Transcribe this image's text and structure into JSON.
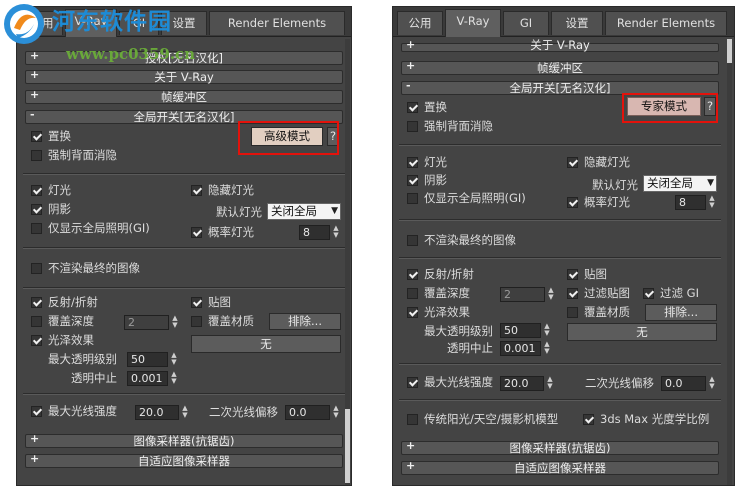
{
  "watermark": {
    "title": "河东软件园",
    "url": "www.pc0359.cn"
  },
  "left": {
    "tabs": [
      "公用",
      "V-Ray",
      "GI",
      "设置",
      "Render Elements"
    ],
    "rollouts_top": [
      {
        "sign": "+",
        "label": "授权[无名汉化]"
      },
      {
        "sign": "+",
        "label": "关于 V-Ray"
      },
      {
        "sign": "+",
        "label": "帧缓冲区"
      }
    ],
    "global": {
      "sign": "-",
      "label": "全局开关[无名汉化]",
      "displacement": "置换",
      "force_back": "强制背面消隐",
      "mode_button": "高级模式",
      "help": "?",
      "lights": "灯光",
      "hidden_lights": "隐藏灯光",
      "shadows": "阴影",
      "default_lights_label": "默认灯光",
      "default_lights_value": "关闭全局",
      "only_gi": "仅显示全局照明(GI)",
      "prob_lights": "概率灯光",
      "prob_lights_value": "8",
      "dont_render": "不渲染最终的图像",
      "refl_refr": "反射/折射",
      "maps": "贴图",
      "override_depth": "覆盖深度",
      "override_depth_value": "2",
      "override_mtl": "覆盖材质",
      "exclude": "排除...",
      "glossy": "光泽效果",
      "none": "无",
      "max_transp_label": "最大透明级别",
      "max_transp_value": "50",
      "transp_cutoff_label": "透明中止",
      "transp_cutoff_value": "0.001",
      "max_ray_label": "最大光线强度",
      "max_ray_value": "20.0",
      "ray_bias_label": "二次光线偏移",
      "ray_bias_value": "0.0"
    },
    "rollouts_bottom": [
      {
        "sign": "+",
        "label": "图像采样器(抗锯齿)"
      },
      {
        "sign": "+",
        "label": "自适应图像采样器"
      }
    ]
  },
  "right": {
    "tabs": [
      "公用",
      "V-Ray",
      "GI",
      "设置",
      "Render Elements"
    ],
    "rollouts_top": [
      {
        "sign": "+",
        "label": "关于 V-Ray"
      },
      {
        "sign": "+",
        "label": "帧缓冲区"
      }
    ],
    "global": {
      "sign": "-",
      "label": "全局开关[无名汉化]",
      "displacement": "置换",
      "force_back": "强制背面消隐",
      "mode_button": "专家模式",
      "help": "?",
      "lights": "灯光",
      "hidden_lights": "隐藏灯光",
      "shadows": "阴影",
      "default_lights_label": "默认灯光",
      "default_lights_value": "关闭全局",
      "only_gi": "仅显示全局照明(GI)",
      "prob_lights": "概率灯光",
      "prob_lights_value": "8",
      "dont_render": "不渲染最终的图像",
      "refl_refr": "反射/折射",
      "maps": "贴图",
      "override_depth": "覆盖深度",
      "override_depth_value": "2",
      "filter_maps": "过滤贴图",
      "filter_gi": "过滤 GI",
      "override_mtl": "覆盖材质",
      "exclude": "排除...",
      "glossy": "光泽效果",
      "none": "无",
      "max_transp_label": "最大透明级别",
      "max_transp_value": "50",
      "transp_cutoff_label": "透明中止",
      "transp_cutoff_value": "0.001",
      "max_ray_label": "最大光线强度",
      "max_ray_value": "20.0",
      "ray_bias_label": "二次光线偏移",
      "ray_bias_value": "0.0",
      "legacy_sun": "传统阳光/天空/摄影机模型",
      "photometric": "3ds Max 光度学比例"
    },
    "rollouts_bottom": [
      {
        "sign": "+",
        "label": "图像采样器(抗锯齿)"
      },
      {
        "sign": "+",
        "label": "自适应图像采样器"
      }
    ]
  }
}
